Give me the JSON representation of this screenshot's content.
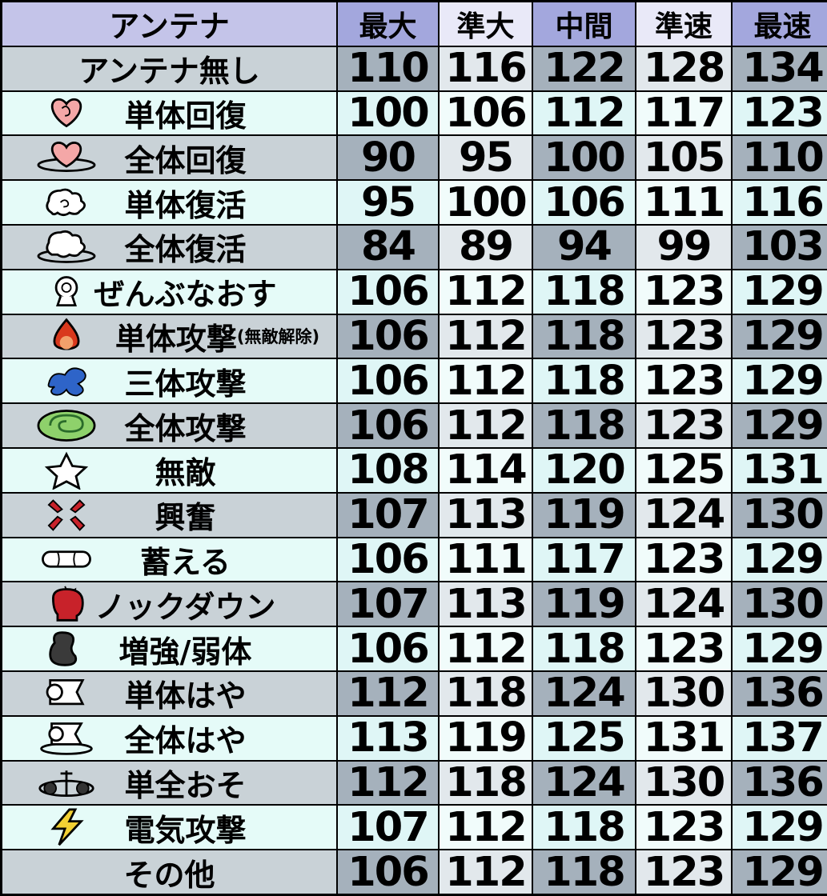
{
  "header": {
    "label": "アンテナ",
    "columns": [
      "最大",
      "準大",
      "中間",
      "準速",
      "最速"
    ]
  },
  "rows": [
    {
      "label": "アンテナ無し",
      "note": "",
      "icon": "none",
      "values": [
        "110",
        "116",
        "122",
        "128",
        "134"
      ]
    },
    {
      "label": "単体回復",
      "note": "",
      "icon": "heart-icon",
      "values": [
        "100",
        "106",
        "112",
        "117",
        "123"
      ]
    },
    {
      "label": "全体回復",
      "note": "",
      "icon": "heart-ring-icon",
      "values": [
        "90",
        "95",
        "100",
        "105",
        "110"
      ]
    },
    {
      "label": "単体復活",
      "note": "",
      "icon": "revive-cloud-icon",
      "values": [
        "95",
        "100",
        "106",
        "111",
        "116"
      ]
    },
    {
      "label": "全体復活",
      "note": "",
      "icon": "revive-cloud-ring-icon",
      "values": [
        "84",
        "89",
        "94",
        "99",
        "103"
      ]
    },
    {
      "label": "ぜんぶなおす",
      "note": "",
      "icon": "cure-all-icon",
      "values": [
        "106",
        "112",
        "118",
        "123",
        "129"
      ]
    },
    {
      "label": "単体攻撃",
      "note": "(無敵解除)",
      "icon": "flame-icon",
      "values": [
        "106",
        "112",
        "118",
        "123",
        "129"
      ]
    },
    {
      "label": "三体攻撃",
      "note": "",
      "icon": "splash-icon",
      "values": [
        "106",
        "112",
        "118",
        "123",
        "129"
      ]
    },
    {
      "label": "全体攻撃",
      "note": "",
      "icon": "whirlwind-icon",
      "values": [
        "106",
        "112",
        "118",
        "123",
        "129"
      ]
    },
    {
      "label": "無敵",
      "note": "",
      "icon": "star-icon",
      "values": [
        "108",
        "114",
        "120",
        "125",
        "131"
      ]
    },
    {
      "label": "興奮",
      "note": "",
      "icon": "anger-icon",
      "values": [
        "107",
        "113",
        "119",
        "124",
        "130"
      ]
    },
    {
      "label": "蓄える",
      "note": "",
      "icon": "capsule-icon",
      "values": [
        "106",
        "111",
        "117",
        "123",
        "129"
      ]
    },
    {
      "label": "ノックダウン",
      "note": "",
      "icon": "boxing-glove-icon",
      "values": [
        "107",
        "113",
        "119",
        "124",
        "130"
      ]
    },
    {
      "label": "増強/弱体",
      "note": "",
      "icon": "bean-icon",
      "values": [
        "106",
        "112",
        "118",
        "123",
        "129"
      ]
    },
    {
      "label": "単体はや",
      "note": "",
      "icon": "speed-flag-icon",
      "values": [
        "112",
        "118",
        "124",
        "130",
        "136"
      ]
    },
    {
      "label": "全体はや",
      "note": "",
      "icon": "speed-flag-ring-icon",
      "values": [
        "113",
        "119",
        "125",
        "131",
        "137"
      ]
    },
    {
      "label": "単全おそ",
      "note": "",
      "icon": "dumbbell-icon",
      "values": [
        "112",
        "118",
        "124",
        "130",
        "136"
      ]
    },
    {
      "label": "電気攻撃",
      "note": "",
      "icon": "lightning-icon",
      "values": [
        "107",
        "112",
        "118",
        "123",
        "129"
      ]
    },
    {
      "label": "その他",
      "note": "",
      "icon": "none",
      "values": [
        "106",
        "112",
        "118",
        "123",
        "129"
      ]
    }
  ],
  "colors": {
    "header_accent": "#a3a7dd",
    "row_gray_dark": "#a5b1bc",
    "row_mint": "#e5fbf8"
  }
}
